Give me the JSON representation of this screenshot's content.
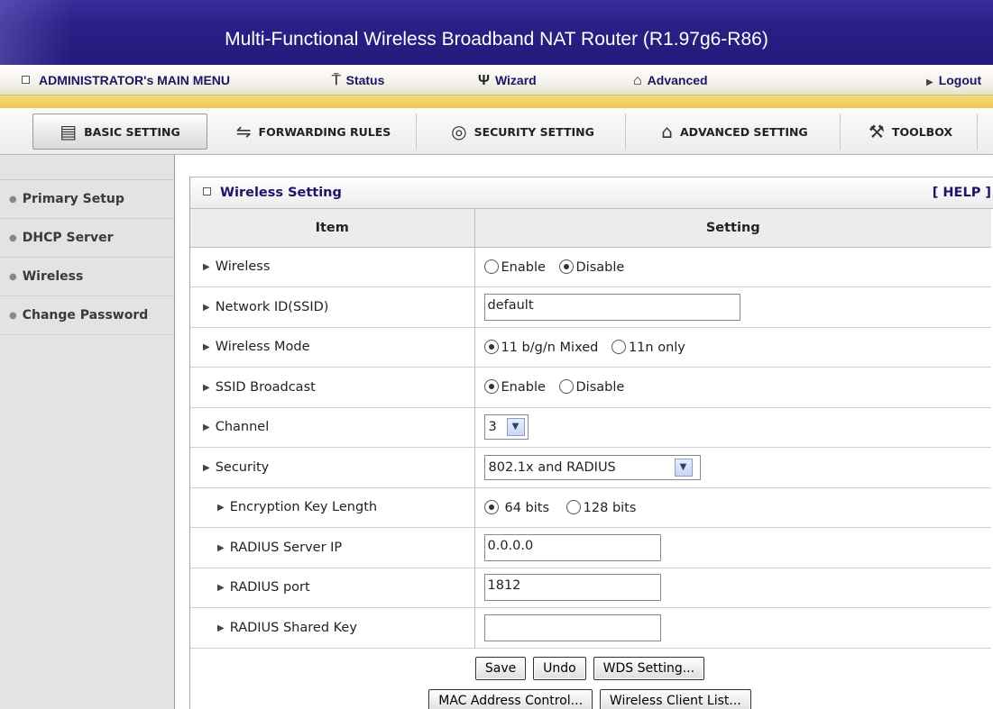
{
  "title": "Multi-Functional Wireless Broadband NAT Router (R1.97g6-R86)",
  "main_menu": {
    "admin_label": "ADMINISTRATOR's MAIN MENU",
    "status_label": "Status",
    "wizard_label": "Wizard",
    "advanced_label": "Advanced",
    "logout_label": "Logout"
  },
  "tabs": [
    {
      "label": "BASIC SETTING",
      "icon": "book-icon",
      "active": true
    },
    {
      "label": "FORWARDING RULES",
      "icon": "arrows-icon",
      "active": false
    },
    {
      "label": "SECURITY SETTING",
      "icon": "shield-icon",
      "active": false
    },
    {
      "label": "ADVANCED SETTING",
      "icon": "advanced-icon",
      "active": false
    },
    {
      "label": "TOOLBOX",
      "icon": "toolbox-icon",
      "active": false
    }
  ],
  "sidebar": {
    "items": [
      {
        "label": "Primary Setup"
      },
      {
        "label": "DHCP Server"
      },
      {
        "label": "Wireless"
      },
      {
        "label": "Change Password"
      }
    ]
  },
  "panel": {
    "title": "Wireless Setting",
    "help_label": "[ HELP ]",
    "header_item": "Item",
    "header_setting": "Setting"
  },
  "rows": {
    "wireless": {
      "label": "Wireless",
      "opt1": "Enable",
      "opt2": "Disable",
      "selected": "Disable"
    },
    "ssid": {
      "label": "Network ID(SSID)",
      "value": "default"
    },
    "mode": {
      "label": "Wireless Mode",
      "opt1": "11 b/g/n Mixed",
      "opt2": "11n only",
      "selected": "11 b/g/n Mixed"
    },
    "broadcast": {
      "label": "SSID Broadcast",
      "opt1": "Enable",
      "opt2": "Disable",
      "selected": "Enable"
    },
    "channel": {
      "label": "Channel",
      "value": "3"
    },
    "security": {
      "label": "Security",
      "value": "802.1x and RADIUS"
    },
    "keylen": {
      "label": "Encryption Key Length",
      "opt1": "64 bits",
      "opt2": "128 bits",
      "selected": "64 bits"
    },
    "radius_ip": {
      "label": "RADIUS Server IP",
      "value": "0.0.0.0"
    },
    "radius_port": {
      "label": "RADIUS port",
      "value": "1812"
    },
    "radius_key": {
      "label": "RADIUS Shared Key",
      "value": ""
    }
  },
  "buttons": {
    "save": "Save",
    "undo": "Undo",
    "wds": "WDS Setting...",
    "mac": "MAC Address Control...",
    "clients": "Wireless Client List..."
  }
}
